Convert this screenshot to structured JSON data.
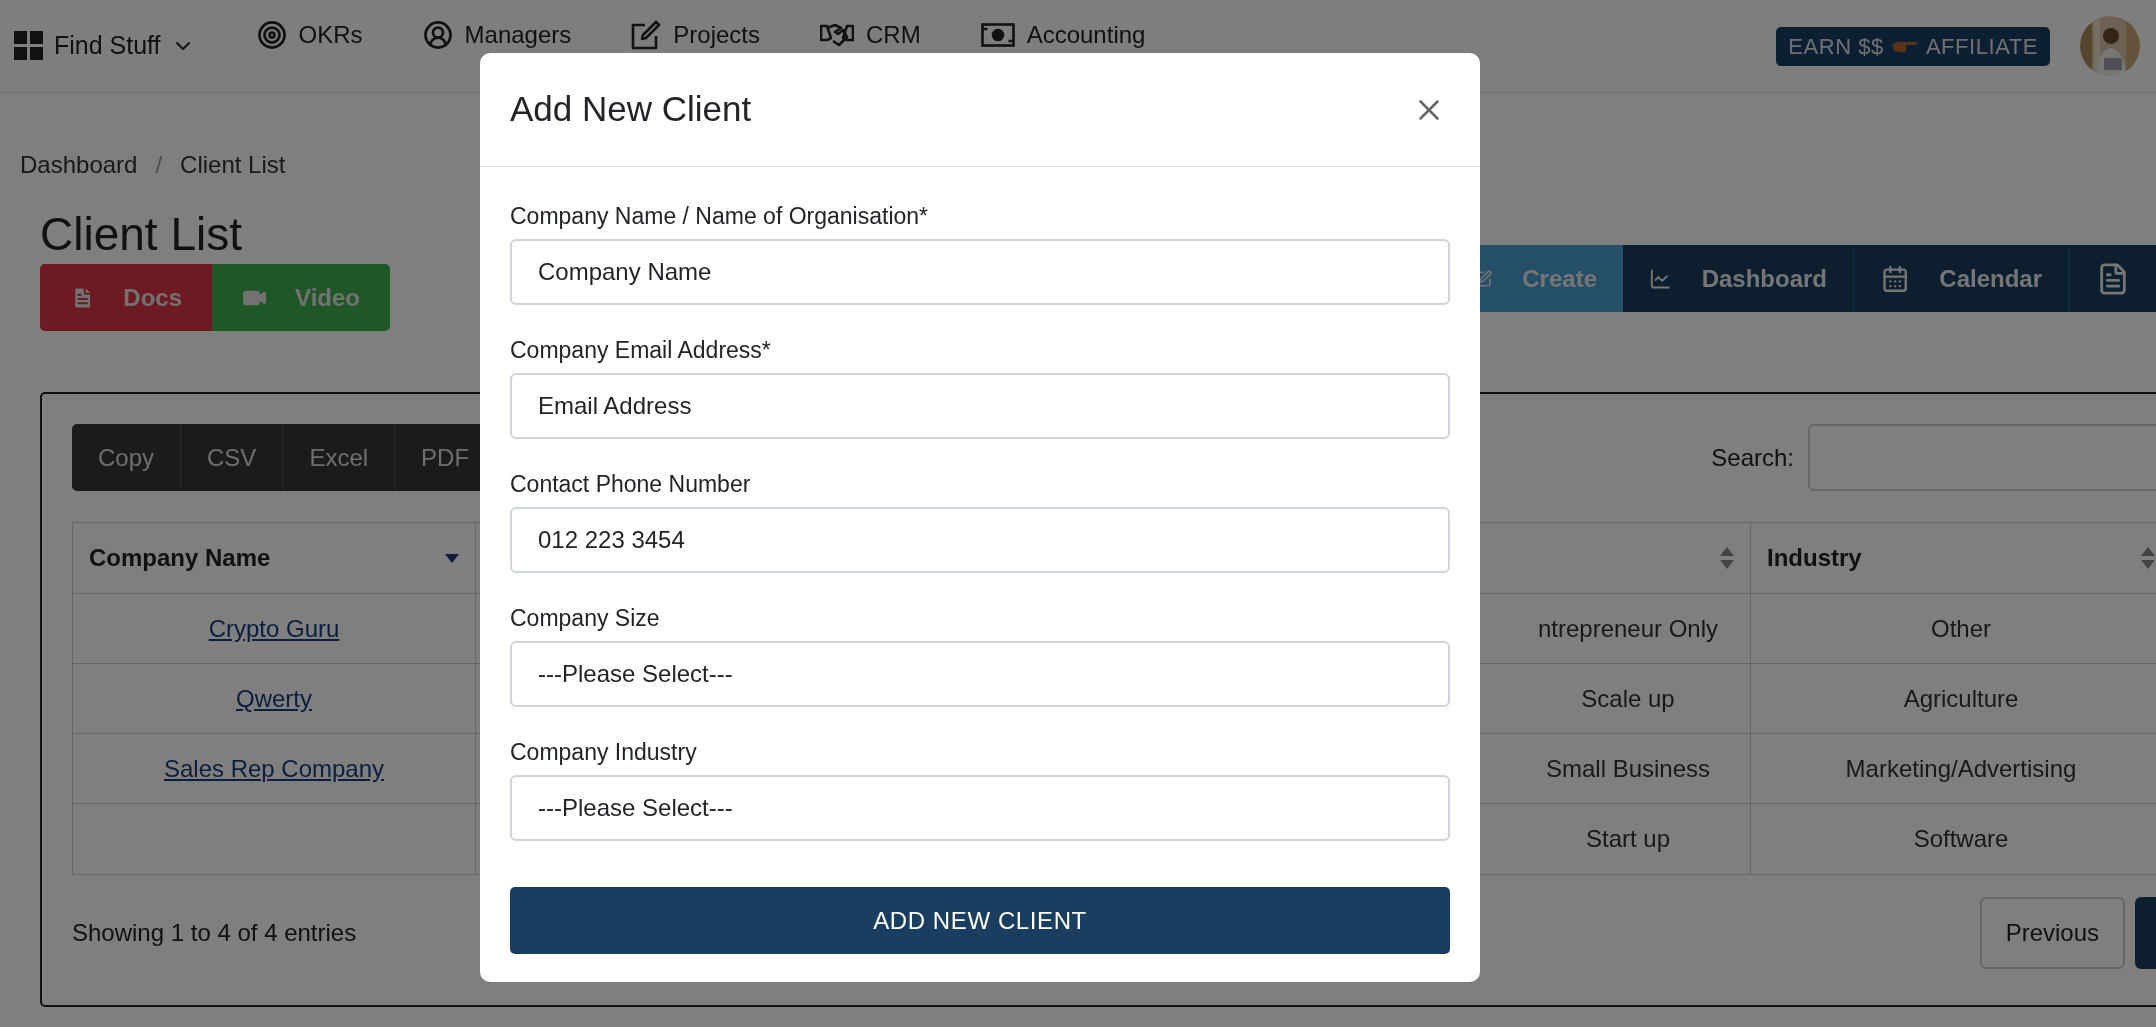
{
  "nav": {
    "menu": {
      "label": "Find Stuff"
    },
    "items": [
      {
        "label": "OKRs",
        "kind": "target"
      },
      {
        "label": "Managers",
        "kind": "user"
      },
      {
        "label": "Projects",
        "kind": "edit"
      },
      {
        "label": "CRM",
        "kind": "handshake"
      },
      {
        "label": "Accounting",
        "kind": "money"
      }
    ],
    "affiliate": {
      "before": "EARN $$",
      "after": "AFFILIATE"
    }
  },
  "breadcrumb": {
    "separator": "/",
    "items": [
      {
        "label": "Dashboard"
      },
      {
        "label": "Client List"
      }
    ]
  },
  "page_title": "Client List",
  "help_buttons": [
    {
      "label": "Docs",
      "kind": "docs"
    },
    {
      "label": "Video",
      "kind": "video"
    }
  ],
  "toolbar": [
    {
      "label": "Create",
      "kind": "create"
    },
    {
      "label": "Dashboard",
      "kind": "dashboard"
    },
    {
      "label": "Calendar",
      "kind": "calendar"
    },
    {
      "kind": "document"
    }
  ],
  "export_buttons": [
    "Copy",
    "CSV",
    "Excel",
    "PDF"
  ],
  "search": {
    "label": "Search:"
  },
  "table": {
    "columns": [
      {
        "label": "Company Name",
        "sorted": true
      },
      {
        "sorted": false
      },
      {
        "label": "Industry",
        "sorted": false
      }
    ],
    "rows": [
      {
        "company_name": "Crypto Guru",
        "column_2": "ntrepreneur Only",
        "industry": "Other"
      },
      {
        "company_name": "Qwerty",
        "column_2": "Scale up",
        "industry": "Agriculture"
      },
      {
        "company_name": "Sales Rep Company",
        "column_2": "Small Business",
        "industry": "Marketing/Advertising"
      },
      {
        "column_2": "Start up",
        "industry": "Software"
      }
    ]
  },
  "footer": {
    "info": "Showing 1 to 4 of 4 entries",
    "pagination": [
      "Previous"
    ]
  },
  "modal": {
    "title": "Add New Client",
    "fields": [
      {
        "label": "Company Name / Name of Organisation*",
        "kind": "text",
        "placeholder": "Company Name"
      },
      {
        "label": "Company Email Address*",
        "kind": "text",
        "placeholder": "Email Address"
      },
      {
        "label": "Contact Phone Number",
        "kind": "text",
        "placeholder": "012 223 3454"
      },
      {
        "label": "Company Size",
        "kind": "select",
        "value": "---Please Select---"
      },
      {
        "label": "Company Industry",
        "kind": "select",
        "value": "---Please Select---"
      }
    ],
    "submit": "ADD NEW CLIENT"
  }
}
